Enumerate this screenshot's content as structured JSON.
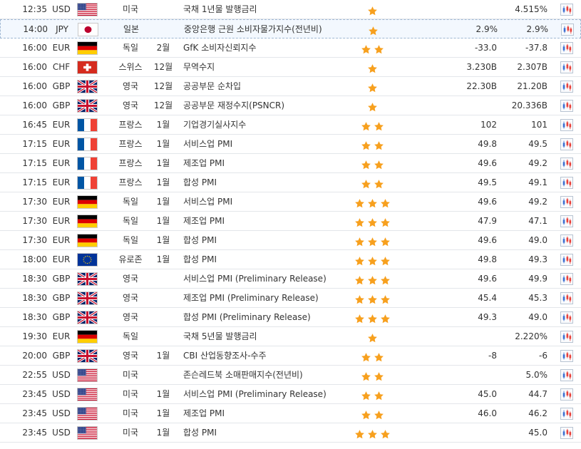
{
  "colors": {
    "star": "#f7a01e",
    "row_border": "#e3e6ea",
    "highlight_bg": "#f3f8fe",
    "chart_red": "#e8403a",
    "chart_blue": "#3b6fd1"
  },
  "rows": [
    {
      "time": "12:35",
      "currency": "USD",
      "flag": "us",
      "country": "미국",
      "period": "",
      "event": "국채 1년물 발행금리",
      "stars": 1,
      "actual": "",
      "previous": "4.515%"
    },
    {
      "time": "14:00",
      "currency": "JPY",
      "flag": "jp",
      "country": "일본",
      "period": "",
      "event": "중앙은행 근원 소비자물가지수(전년비)",
      "stars": 1,
      "actual": "2.9%",
      "previous": "2.9%",
      "highlight": true
    },
    {
      "time": "16:00",
      "currency": "EUR",
      "flag": "de",
      "country": "독일",
      "period": "2월",
      "event": "GfK 소비자신뢰지수",
      "stars": 2,
      "actual": "-33.0",
      "previous": "-37.8"
    },
    {
      "time": "16:00",
      "currency": "CHF",
      "flag": "ch",
      "country": "스위스",
      "period": "12월",
      "event": "무역수지",
      "stars": 1,
      "actual": "3.230B",
      "previous": "2.307B"
    },
    {
      "time": "16:00",
      "currency": "GBP",
      "flag": "gb",
      "country": "영국",
      "period": "12월",
      "event": "공공부문 순차입",
      "stars": 1,
      "actual": "22.30B",
      "previous": "21.20B"
    },
    {
      "time": "16:00",
      "currency": "GBP",
      "flag": "gb",
      "country": "영국",
      "period": "12월",
      "event": "공공부문 재정수지(PSNCR)",
      "stars": 1,
      "actual": "",
      "previous": "20.336B"
    },
    {
      "time": "16:45",
      "currency": "EUR",
      "flag": "fr",
      "country": "프랑스",
      "period": "1월",
      "event": "기업경기실사지수",
      "stars": 2,
      "actual": "102",
      "previous": "101"
    },
    {
      "time": "17:15",
      "currency": "EUR",
      "flag": "fr",
      "country": "프랑스",
      "period": "1월",
      "event": "서비스업 PMI",
      "stars": 2,
      "actual": "49.8",
      "previous": "49.5"
    },
    {
      "time": "17:15",
      "currency": "EUR",
      "flag": "fr",
      "country": "프랑스",
      "period": "1월",
      "event": "제조업 PMI",
      "stars": 2,
      "actual": "49.6",
      "previous": "49.2"
    },
    {
      "time": "17:15",
      "currency": "EUR",
      "flag": "fr",
      "country": "프랑스",
      "period": "1월",
      "event": "합성 PMI",
      "stars": 2,
      "actual": "49.5",
      "previous": "49.1"
    },
    {
      "time": "17:30",
      "currency": "EUR",
      "flag": "de",
      "country": "독일",
      "period": "1월",
      "event": "서비스업 PMI",
      "stars": 3,
      "actual": "49.6",
      "previous": "49.2"
    },
    {
      "time": "17:30",
      "currency": "EUR",
      "flag": "de",
      "country": "독일",
      "period": "1월",
      "event": "제조업 PMI",
      "stars": 3,
      "actual": "47.9",
      "previous": "47.1"
    },
    {
      "time": "17:30",
      "currency": "EUR",
      "flag": "de",
      "country": "독일",
      "period": "1월",
      "event": "합성 PMI",
      "stars": 3,
      "actual": "49.6",
      "previous": "49.0"
    },
    {
      "time": "18:00",
      "currency": "EUR",
      "flag": "eu",
      "country": "유로존",
      "period": "1월",
      "event": "합성 PMI",
      "stars": 3,
      "actual": "49.8",
      "previous": "49.3"
    },
    {
      "time": "18:30",
      "currency": "GBP",
      "flag": "gb",
      "country": "영국",
      "period": "",
      "event": "서비스업 PMI (Preliminary Release)",
      "stars": 3,
      "actual": "49.6",
      "previous": "49.9"
    },
    {
      "time": "18:30",
      "currency": "GBP",
      "flag": "gb",
      "country": "영국",
      "period": "",
      "event": "제조업 PMI (Preliminary Release)",
      "stars": 3,
      "actual": "45.4",
      "previous": "45.3"
    },
    {
      "time": "18:30",
      "currency": "GBP",
      "flag": "gb",
      "country": "영국",
      "period": "",
      "event": "합성 PMI (Preliminary Release)",
      "stars": 3,
      "actual": "49.3",
      "previous": "49.0"
    },
    {
      "time": "19:30",
      "currency": "EUR",
      "flag": "de",
      "country": "독일",
      "period": "",
      "event": "국채 5년물 발행금리",
      "stars": 1,
      "actual": "",
      "previous": "2.220%"
    },
    {
      "time": "20:00",
      "currency": "GBP",
      "flag": "gb",
      "country": "영국",
      "period": "1월",
      "event": "CBI 산업동향조사-수주",
      "stars": 2,
      "actual": "-8",
      "previous": "-6"
    },
    {
      "time": "22:55",
      "currency": "USD",
      "flag": "us",
      "country": "미국",
      "period": "",
      "event": "존슨레드북 소매판매지수(전년비)",
      "stars": 2,
      "actual": "",
      "previous": "5.0%"
    },
    {
      "time": "23:45",
      "currency": "USD",
      "flag": "us",
      "country": "미국",
      "period": "1월",
      "event": "서비스업 PMI (Preliminary Release)",
      "stars": 2,
      "actual": "45.0",
      "previous": "44.7"
    },
    {
      "time": "23:45",
      "currency": "USD",
      "flag": "us",
      "country": "미국",
      "period": "1월",
      "event": "제조업 PMI",
      "stars": 2,
      "actual": "46.0",
      "previous": "46.2"
    },
    {
      "time": "23:45",
      "currency": "USD",
      "flag": "us",
      "country": "미국",
      "period": "1월",
      "event": "합성 PMI",
      "stars": 3,
      "actual": "",
      "previous": "45.0"
    }
  ]
}
